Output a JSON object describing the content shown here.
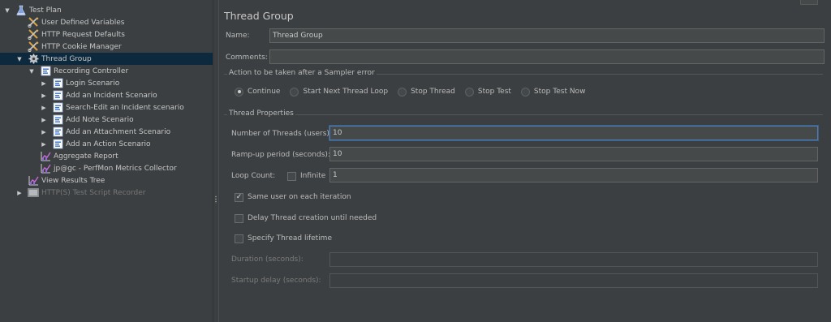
{
  "tree": {
    "items": [
      {
        "label": "Test Plan",
        "icon": "flask-icon",
        "indent": 0,
        "arrow": "▼",
        "color": "#6a8ccf"
      },
      {
        "label": "User Defined Variables",
        "icon": "wrench-scissors-icon",
        "indent": 1,
        "arrow": ""
      },
      {
        "label": "HTTP Request Defaults",
        "icon": "wrench-scissors-icon",
        "indent": 1,
        "arrow": ""
      },
      {
        "label": "HTTP Cookie Manager",
        "icon": "wrench-scissors-icon",
        "indent": 1,
        "arrow": ""
      },
      {
        "label": "Thread Group",
        "icon": "gear-icon",
        "indent": 1,
        "arrow": "▼",
        "selected": true
      },
      {
        "label": "Recording Controller",
        "icon": "controller-icon",
        "indent": 2,
        "arrow": "▼"
      },
      {
        "label": "Login Scenario",
        "icon": "controller-icon",
        "indent": 3,
        "arrow": "▶"
      },
      {
        "label": "Add an Incident Scenario",
        "icon": "controller-icon",
        "indent": 3,
        "arrow": "▶"
      },
      {
        "label": "Search-Edit an Incident scenario",
        "icon": "controller-icon",
        "indent": 3,
        "arrow": "▶"
      },
      {
        "label": "Add Note Scenario",
        "icon": "controller-icon",
        "indent": 3,
        "arrow": "▶"
      },
      {
        "label": "Add an Attachment Scenario",
        "icon": "controller-icon",
        "indent": 3,
        "arrow": "▶"
      },
      {
        "label": "Add an Action Scenario",
        "icon": "controller-icon",
        "indent": 3,
        "arrow": "▶"
      },
      {
        "label": "Aggregate Report",
        "icon": "chart-icon",
        "indent": 2,
        "arrow": ""
      },
      {
        "label": "jp@gc - PerfMon Metrics Collector",
        "icon": "chart-icon",
        "indent": 2,
        "arrow": ""
      },
      {
        "label": "View Results Tree",
        "icon": "chart-icon",
        "indent": 1,
        "arrow": ""
      },
      {
        "label": "HTTP(S) Test Script Recorder",
        "icon": "recorder-icon",
        "indent": 1,
        "arrow": "▶",
        "disabled": true
      }
    ]
  },
  "panel": {
    "title": "Thread Group",
    "name_label": "Name:",
    "name_value": "Thread Group",
    "comments_label": "Comments:",
    "comments_value": "",
    "sampler_error": {
      "title": "Action to be taken after a Sampler error",
      "options": [
        {
          "label": "Continue",
          "selected": true
        },
        {
          "label": "Start Next Thread Loop",
          "selected": false
        },
        {
          "label": "Stop Thread",
          "selected": false
        },
        {
          "label": "Stop Test",
          "selected": false
        },
        {
          "label": "Stop Test Now",
          "selected": false
        }
      ]
    },
    "thread_props": {
      "title": "Thread Properties",
      "threads_label": "Number of Threads (users):",
      "threads_value": "10",
      "rampup_label": "Ramp-up period (seconds):",
      "rampup_value": "10",
      "loop_label": "Loop Count:",
      "infinite_label": "Infinite",
      "infinite_checked": false,
      "loop_value": "1",
      "same_user_label": "Same user on each iteration",
      "same_user_checked": true,
      "delay_label": "Delay Thread creation until needed",
      "delay_checked": false,
      "lifetime_label": "Specify Thread lifetime",
      "lifetime_checked": false,
      "duration_label": "Duration (seconds):",
      "duration_value": "",
      "startup_label": "Startup delay (seconds):",
      "startup_value": ""
    }
  },
  "colors": {
    "background": "#3c3f41",
    "selection": "#0d293e",
    "focus_border": "#4f7bb3"
  }
}
